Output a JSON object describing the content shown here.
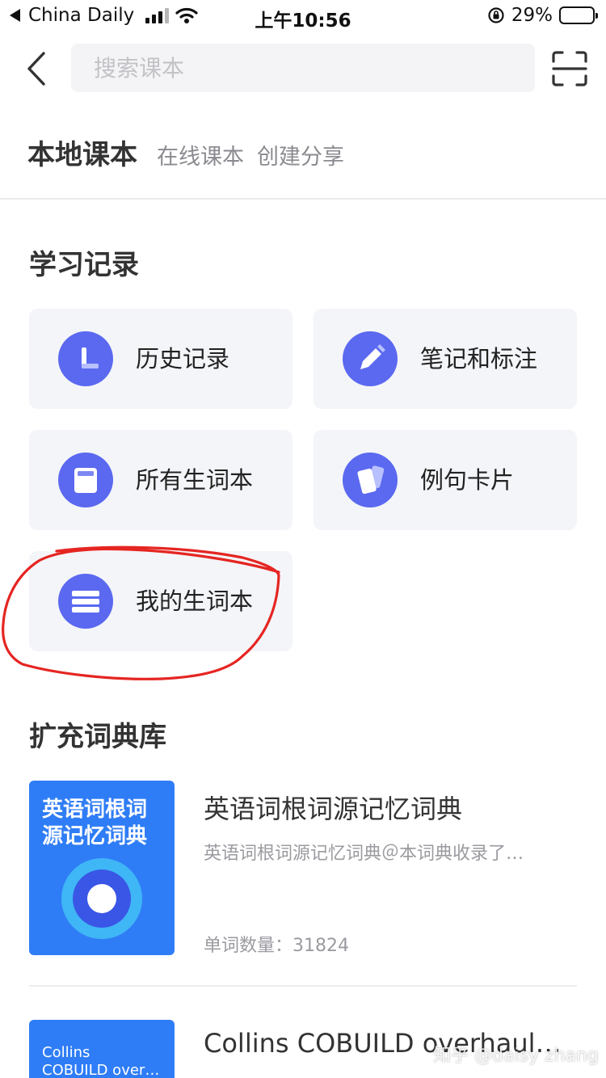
{
  "status_bar": {
    "carrier": "China Daily",
    "time": "上午10:56",
    "battery": "29%",
    "battery_level": 0.29
  },
  "header": {
    "search_placeholder": "搜索课本",
    "back_icon": "chevron-left-icon",
    "scan_icon": "scan-icon"
  },
  "tabs": [
    {
      "label": "本地课本",
      "active": true
    },
    {
      "label": "在线课本",
      "active": false
    },
    {
      "label": "创建分享",
      "active": false
    }
  ],
  "study": {
    "title": "学习记录",
    "items": [
      {
        "label": "历史记录",
        "icon": "clock-icon"
      },
      {
        "label": "笔记和标注",
        "icon": "pencil-icon"
      },
      {
        "label": "所有生词本",
        "icon": "notebook-icon"
      },
      {
        "label": "例句卡片",
        "icon": "cards-icon"
      },
      {
        "label": "我的生词本",
        "icon": "list-icon"
      }
    ]
  },
  "dictionaries": {
    "title": "扩充词典库",
    "items": [
      {
        "cover_title": "英语词根词源记忆词典",
        "title": "英语词根词源记忆词典",
        "description": "英语词根词源记忆词典＠本词典收录了…",
        "count_label": "单词数量：",
        "count": "31824"
      },
      {
        "cover_line1": "Collins",
        "cover_line2": "COBUILD over…",
        "title": "Collins COBUILD overhaul…"
      }
    ]
  },
  "watermark": "知乎 @daisy zhang",
  "colors": {
    "accent": "#5b69f0",
    "card_bg": "#f4f5f9",
    "cover_blue": "#2f7df6",
    "annotation_red": "#e52521"
  }
}
